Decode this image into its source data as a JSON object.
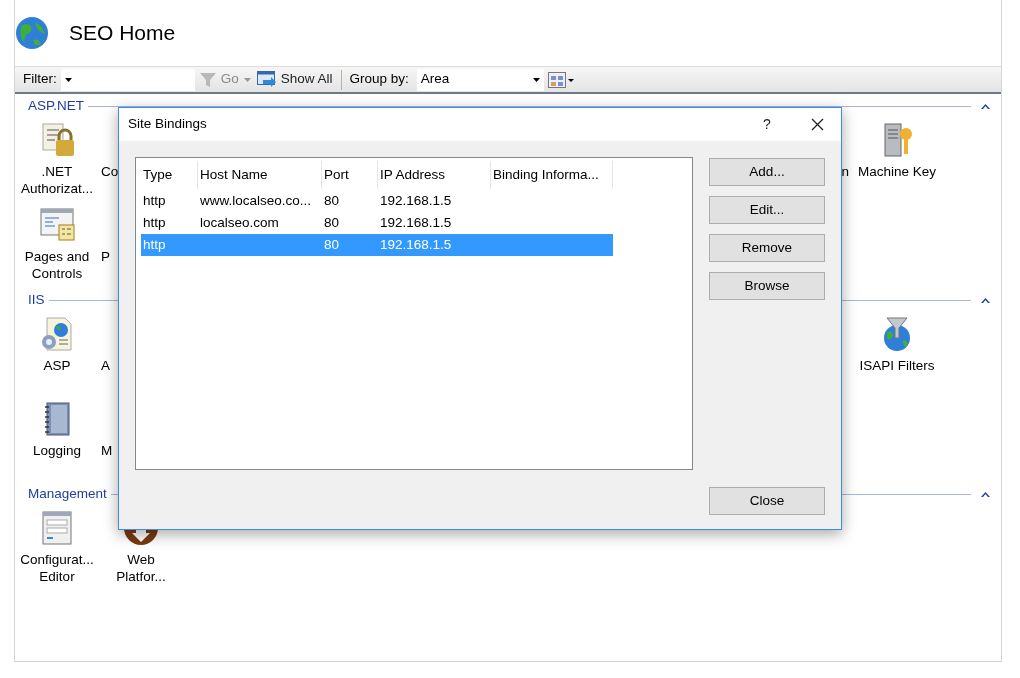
{
  "page": {
    "title": "SEO Home"
  },
  "toolbar": {
    "filter_label": "Filter:",
    "go": {
      "label": "Go",
      "disabled": true
    },
    "show_all": "Show All",
    "group_by_label": "Group by:",
    "group_by_value": "Area"
  },
  "sections": [
    {
      "title": "ASP.NET",
      "expanded": true,
      "rows": [
        {
          "left": [
            {
              "kind": "lock",
              "label": ".NET Authorizat..."
            },
            {
              "kind": "partial",
              "label": "Co"
            }
          ],
          "right": [
            {
              "kind": "partial",
              "label": "n"
            },
            {
              "kind": "key",
              "label": "Machine Key"
            }
          ]
        },
        {
          "left": [
            {
              "kind": "pages",
              "label": "Pages and Controls"
            },
            {
              "kind": "partial",
              "label": "P"
            }
          ],
          "right": []
        }
      ]
    },
    {
      "title": "IIS",
      "expanded": true,
      "rows": [
        {
          "left": [
            {
              "kind": "asp",
              "label": "ASP"
            },
            {
              "kind": "partial",
              "label": "A"
            }
          ],
          "right": [
            {
              "kind": "isapi",
              "label": "ISAPI Filters"
            }
          ]
        },
        {
          "left": [
            {
              "kind": "log",
              "label": "Logging"
            },
            {
              "kind": "partial",
              "label": "M"
            }
          ],
          "right": []
        }
      ]
    },
    {
      "title": "Management",
      "expanded": true,
      "rows": [
        {
          "left": [
            {
              "kind": "config",
              "label": "Configurat... Editor"
            },
            {
              "kind": "webpi",
              "label": "Web Platfor..."
            }
          ],
          "right": []
        }
      ]
    }
  ],
  "dialog": {
    "title": "Site Bindings",
    "help": "?",
    "columns": [
      "Type",
      "Host Name",
      "Port",
      "IP Address",
      "Binding Informa..."
    ],
    "rows": [
      {
        "cells": [
          "http",
          "www.localseo.co...",
          "80",
          "192.168.1.5",
          ""
        ],
        "selected": false
      },
      {
        "cells": [
          "http",
          "localseo.com",
          "80",
          "192.168.1.5",
          ""
        ],
        "selected": false
      },
      {
        "cells": [
          "http",
          "",
          "80",
          "192.168.1.5",
          ""
        ],
        "selected": true
      }
    ],
    "buttons": [
      "Add...",
      "Edit...",
      "Remove",
      "Browse"
    ],
    "close": "Close"
  }
}
